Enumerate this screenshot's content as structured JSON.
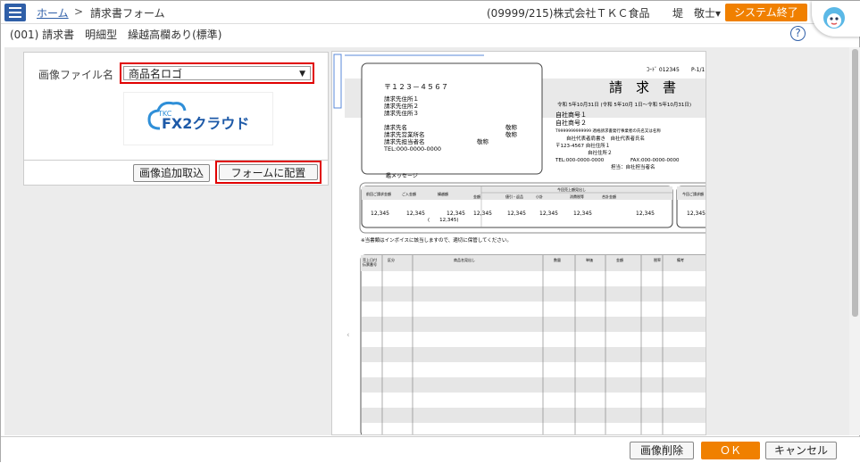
{
  "header": {
    "home": "ホーム",
    "separator": ">",
    "page": "請求書フォーム",
    "company": "(09999/215)株式会社ＴＫＣ食品",
    "user": "堤　敬士▾",
    "exit": "システム終了"
  },
  "subheader": {
    "form_name": "(001) 請求書　明細型　繰越高欄あり(標準)",
    "help": "?"
  },
  "left_panel": {
    "file_label": "画像ファイル名",
    "file_value": "商品名ロゴ",
    "logo_small": "TKC",
    "logo_main": "FX2クラウド",
    "add_image": "画像追加取込",
    "place_on_form": "フォームに配置"
  },
  "invoice": {
    "code": "ｺｰﾄﾞ 012345",
    "page": "P-1/1",
    "title": "請　求　書",
    "date_range": "令和 5年10月31日 (令和 5年10月 1日～令和 5年10月31日)",
    "postal": "〒１２３－４５６７",
    "address1": "請求先住所１",
    "address2": "請求先住所２",
    "address3": "請求先住所３",
    "name": "請求先名",
    "office": "請求先営業所名",
    "person": "請求先担当者名",
    "honorific": "敬称",
    "tel": "TEL:000-0000-0000",
    "own_name1": "自社商号１",
    "own_name2": "自社商号２",
    "reg_no": "T9999999999999 適格請求書発行事業者の氏名又は名称",
    "rep": "自社代表者肩書き　自社代表者氏名",
    "own_addr1": "〒123-4567 自社住所１",
    "own_addr2": "自社住所２",
    "own_tel": "TEL:000-0000-0000",
    "own_fax": "FAX:000-0000-0000",
    "own_person": "担当：自社担当者名",
    "message": "鑑メッセージ",
    "sum_headers": [
      "前回ご請求金額",
      "ご入金額",
      "繰越額",
      "金額",
      "値引・返品",
      "小計",
      "消費税等",
      "合計金額",
      "今回ご請求額"
    ],
    "sum_group": "今回売上額見出し",
    "sum_values": [
      "12,345",
      "12,345",
      "12,345",
      "12,345",
      "12,345",
      "12,345",
      "12,345",
      "12,345",
      "12,345"
    ],
    "sum_paren": "(　　12,345)",
    "note": "※当書類はインボイスに該当しますので、適切に保管してください。",
    "detail_headers": [
      "売上日付\n伝票番号",
      "区分",
      "商品名見出し",
      "数量",
      "単価",
      "金額",
      "税率",
      "備考"
    ]
  },
  "footer": {
    "delete_image": "画像削除",
    "ok": "ＯＫ",
    "cancel": "キャンセル"
  },
  "colors": {
    "accent_blue": "#2f5fa8",
    "accent_orange": "#f08000",
    "highlight_red": "#e00000"
  }
}
